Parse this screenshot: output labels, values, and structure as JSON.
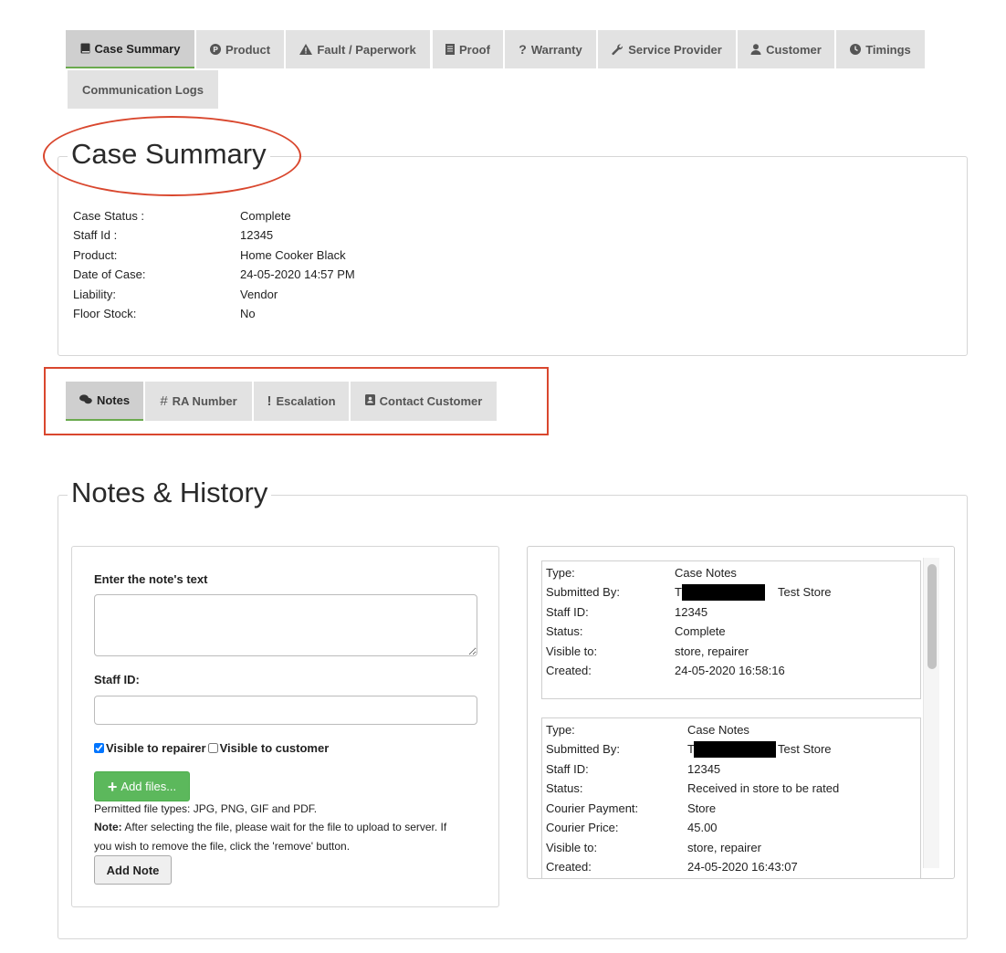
{
  "tabs": [
    {
      "label": "Case Summary",
      "icon": "book-icon",
      "active": true
    },
    {
      "label": "Product",
      "icon": "product-circle-icon"
    },
    {
      "label": "Fault / Paperwork",
      "icon": "warning-icon"
    },
    {
      "label": "Proof",
      "icon": "document-icon"
    },
    {
      "label": "Warranty",
      "icon": "question-icon"
    },
    {
      "label": "Service Provider",
      "icon": "wrench-icon"
    },
    {
      "label": "Customer",
      "icon": "user-icon"
    },
    {
      "label": "Timings",
      "icon": "clock-icon"
    },
    {
      "label": "Communication Logs"
    }
  ],
  "case_summary": {
    "title": "Case Summary",
    "rows": [
      {
        "label": "Case Status :",
        "value": "Complete"
      },
      {
        "label": "Staff Id :",
        "value": "12345"
      },
      {
        "label": "Product:",
        "value": "Home Cooker Black"
      },
      {
        "label": "Date of Case:",
        "value": "24-05-2020 14:57 PM"
      },
      {
        "label": "Liability:",
        "value": "Vendor"
      },
      {
        "label": "Floor Stock:",
        "value": "No"
      }
    ]
  },
  "subtabs": [
    {
      "label": "Notes",
      "icon": "chat-icon",
      "active": true
    },
    {
      "label": "RA Number",
      "icon": "hash-icon"
    },
    {
      "label": "Escalation",
      "icon": "exclamation-icon"
    },
    {
      "label": "Contact Customer",
      "icon": "contact-card-icon"
    }
  ],
  "notes_history": {
    "title": "Notes & History",
    "form": {
      "note_label": "Enter the note's text",
      "note_value": "",
      "staff_id_label": "Staff ID:",
      "staff_id_value": "",
      "visible_repairer": "Visible to repairer",
      "visible_repairer_checked": true,
      "visible_customer": "Visible to customer",
      "visible_customer_checked": false,
      "add_files_label": "Add files...",
      "permitted": "Permitted file types: JPG, PNG, GIF and PDF.",
      "note_bold": "Note:",
      "note_text_1": " After selecting the file, please wait for the file to upload to server. If",
      "note_text_2": "you wish to remove the file, click the 'remove' button.",
      "add_note_label": "Add Note"
    },
    "entries": [
      {
        "rows": [
          {
            "label": "Type:",
            "value": "Case Notes"
          },
          {
            "label": "Submitted By:",
            "value_prefix": "T",
            "value": "Test Store",
            "redacted": true
          },
          {
            "label": "Staff ID:",
            "value": "12345"
          },
          {
            "label": "Status:",
            "value": "Complete"
          },
          {
            "label": "Visible to:",
            "value": "store, repairer"
          },
          {
            "label": "Created:",
            "value": "24-05-2020 16:58:16"
          }
        ]
      },
      {
        "rows": [
          {
            "label": "Type:",
            "value": "Case Notes"
          },
          {
            "label": "Submitted By:",
            "value_prefix": "T",
            "value": "Test Store",
            "redacted": true
          },
          {
            "label": "Staff ID:",
            "value": "12345"
          },
          {
            "label": "Status:",
            "value": "Received in store to be rated"
          },
          {
            "label": "Courier Payment:",
            "value": "Store"
          },
          {
            "label": "Courier Price:",
            "value": "45.00"
          },
          {
            "label": "Visible to:",
            "value": "store, repairer"
          },
          {
            "label": "Created:",
            "value": "24-05-2020 16:43:07"
          }
        ]
      }
    ]
  },
  "colors": {
    "accent_green": "#5cb85c",
    "annotation_red": "#d9472e"
  }
}
